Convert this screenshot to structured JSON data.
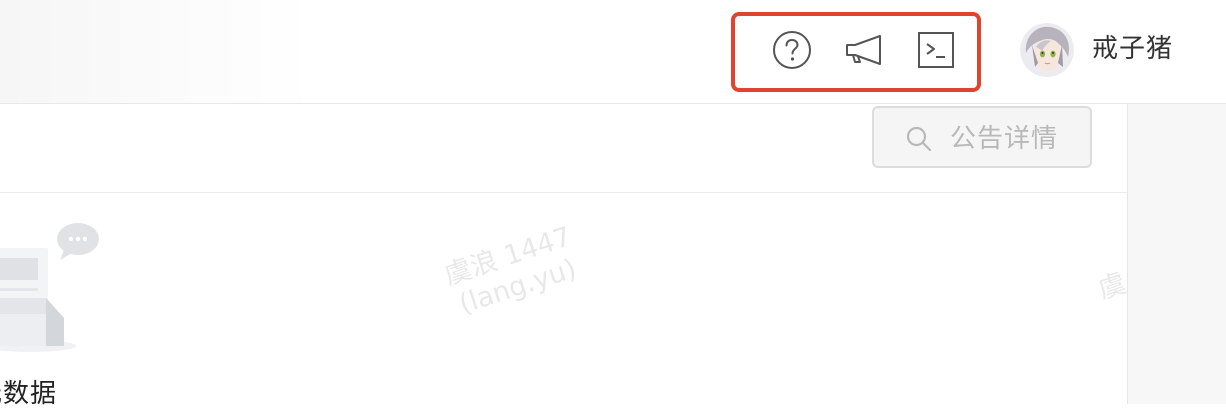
{
  "header": {
    "icons": [
      {
        "name": "help-icon",
        "kind": "help"
      },
      {
        "name": "announcement-icon",
        "kind": "megaphone"
      },
      {
        "name": "terminal-icon",
        "kind": "terminal"
      }
    ],
    "highlight_color": "#e0432f",
    "user": {
      "name": "戒子猪",
      "avatar": "avatar"
    }
  },
  "toolbar": {
    "search_label": "公告详情",
    "search_icon": "search-icon"
  },
  "empty_state": {
    "text": "元数据"
  },
  "watermark": {
    "line1": "虞浪 1447",
    "line2": "(lang.yu)",
    "partial": "虞"
  }
}
